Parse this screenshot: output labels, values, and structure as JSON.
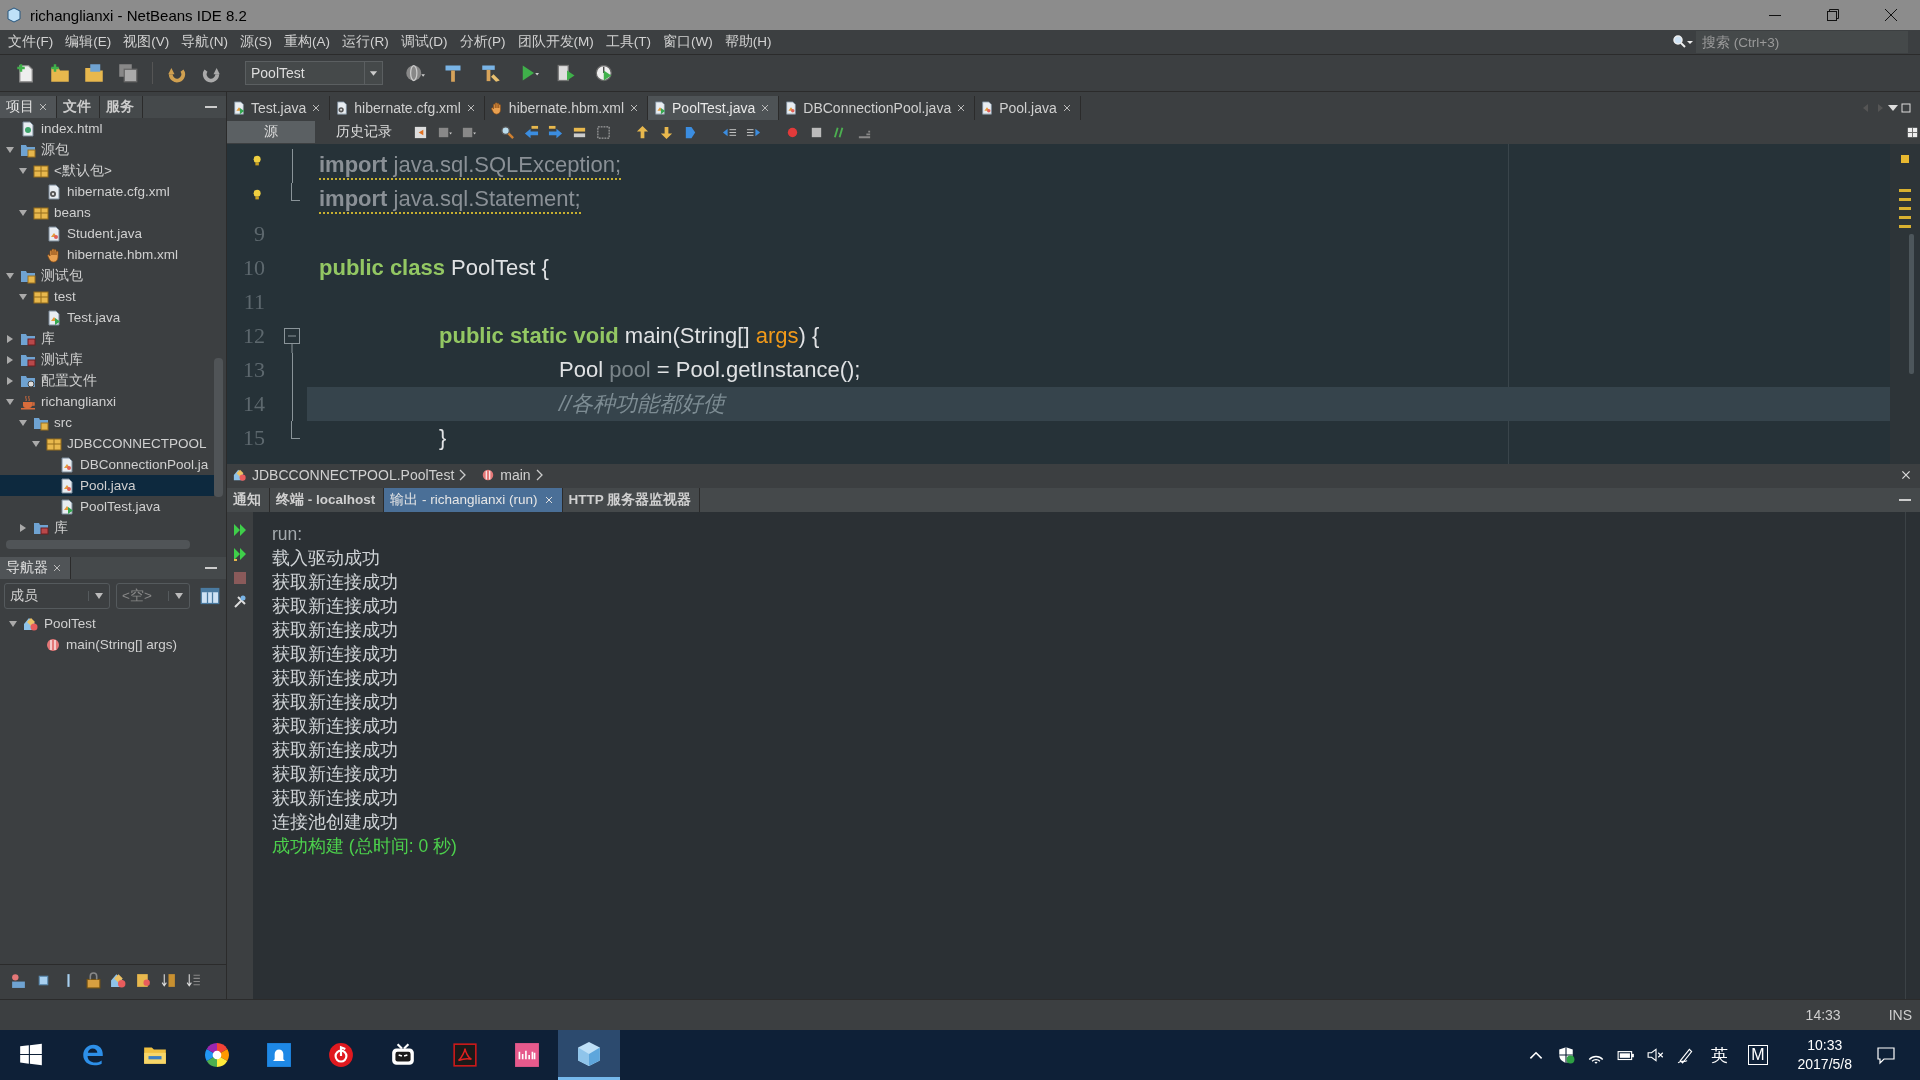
{
  "window": {
    "title": "richanglianxi - NetBeans IDE 8.2"
  },
  "menu": [
    "文件(F)",
    "编辑(E)",
    "视图(V)",
    "导航(N)",
    "源(S)",
    "重构(A)",
    "运行(R)",
    "调试(D)",
    "分析(P)",
    "团队开发(M)",
    "工具(T)",
    "窗口(W)",
    "帮助(H)"
  ],
  "search": {
    "placeholder": "搜索 (Ctrl+3)"
  },
  "toolbar": {
    "configuration": "PoolTest"
  },
  "project_panel": {
    "tabs": [
      {
        "label": "项目",
        "selected": true,
        "closable": true
      },
      {
        "label": "文件",
        "selected": false,
        "closable": false
      },
      {
        "label": "服务",
        "selected": false,
        "closable": false
      }
    ],
    "tree": [
      {
        "label": "index.html",
        "kind": "html",
        "selected": false
      },
      {
        "label": "源包",
        "kind": "source-root",
        "selected": false,
        "expanded": true,
        "children": [
          {
            "label": "<默认包>",
            "kind": "package",
            "selected": false,
            "expanded": true,
            "children": [
              {
                "label": "hibernate.cfg.xml",
                "kind": "xml",
                "selected": false
              }
            ]
          },
          {
            "label": "beans",
            "kind": "package",
            "selected": false,
            "expanded": true,
            "children": [
              {
                "label": "Student.java",
                "kind": "java",
                "selected": false
              },
              {
                "label": "hibernate.hbm.xml",
                "kind": "hbm",
                "selected": false
              }
            ]
          }
        ]
      },
      {
        "label": "测试包",
        "kind": "source-root",
        "selected": false,
        "expanded": true,
        "children": [
          {
            "label": "test",
            "kind": "package",
            "selected": false,
            "expanded": true,
            "children": [
              {
                "label": "Test.java",
                "kind": "java-main",
                "selected": false
              }
            ]
          }
        ]
      },
      {
        "label": "库",
        "kind": "library",
        "selected": false,
        "expanded": false
      },
      {
        "label": "测试库",
        "kind": "library",
        "selected": false,
        "expanded": false
      },
      {
        "label": "配置文件",
        "kind": "config",
        "selected": false,
        "expanded": false
      },
      {
        "label": "richanglianxi",
        "kind": "project",
        "selected": false,
        "expanded": true,
        "children": [
          {
            "label": "src",
            "kind": "source-root",
            "selected": false,
            "expanded": true,
            "children": [
              {
                "label": "JDBCCONNECTPOOL",
                "kind": "package",
                "selected": false,
                "expanded": true,
                "children": [
                  {
                    "label": "DBConnectionPool.ja",
                    "kind": "java",
                    "selected": false
                  },
                  {
                    "label": "Pool.java",
                    "kind": "java",
                    "selected": true
                  },
                  {
                    "label": "PoolTest.java",
                    "kind": "java-main",
                    "selected": false
                  }
                ]
              }
            ]
          },
          {
            "label": "库",
            "kind": "library",
            "selected": false,
            "expanded": false
          }
        ]
      }
    ]
  },
  "navigator": {
    "title": "导航器",
    "filters": [
      "成员",
      "<空>"
    ],
    "tree": [
      {
        "label": "PoolTest",
        "kind": "class",
        "selected": false,
        "expanded": true,
        "children": [
          {
            "label": "main(String[] args)",
            "kind": "method",
            "selected": false
          }
        ]
      }
    ]
  },
  "editor": {
    "tabs": [
      {
        "label": "Test.java",
        "kind": "java-main",
        "selected": false
      },
      {
        "label": "hibernate.cfg.xml",
        "kind": "xml",
        "selected": false
      },
      {
        "label": "hibernate.hbm.xml",
        "kind": "hbm",
        "selected": false
      },
      {
        "label": "PoolTest.java",
        "kind": "java-main",
        "selected": true
      },
      {
        "label": "DBConnectionPool.java",
        "kind": "java",
        "selected": false
      },
      {
        "label": "Pool.java",
        "kind": "java",
        "selected": false
      }
    ],
    "views": [
      {
        "label": "源",
        "selected": true
      },
      {
        "label": "历史记录",
        "selected": false
      }
    ],
    "lines": [
      {
        "hint": true,
        "fold": {
          "kind": "mid"
        },
        "current": false,
        "warning": true,
        "tokens": [
          {
            "kind": "import-keyword",
            "text": "import"
          },
          {
            "kind": "import",
            "text": " java.sql.SQLException;"
          }
        ]
      },
      {
        "hint": true,
        "fold": {
          "kind": "end"
        },
        "current": false,
        "warning": true,
        "tokens": [
          {
            "kind": "import-keyword",
            "text": "import"
          },
          {
            "kind": "import",
            "text": " java.sql.Statement;"
          }
        ]
      },
      {
        "number": "9",
        "hint": false,
        "current": false
      },
      {
        "number": "10",
        "hint": false,
        "current": false,
        "warning": false,
        "tokens": [
          {
            "kind": "keyword",
            "text": "public class"
          },
          {
            "kind": "plain",
            "text": " PoolTest {"
          }
        ]
      },
      {
        "number": "11",
        "hint": false,
        "current": false
      },
      {
        "number": "12",
        "hint": false,
        "fold": {
          "kind": "start"
        },
        "current": false,
        "warning": false,
        "tokens": [
          {
            "kind": "keyword",
            "text": "\tpublic static void"
          },
          {
            "kind": "plain",
            "text": " main(String[] "
          },
          {
            "kind": "param",
            "text": "args"
          },
          {
            "kind": "plain",
            "text": ") {"
          }
        ]
      },
      {
        "number": "13",
        "hint": false,
        "fold": {
          "kind": "mid"
        },
        "current": false,
        "warning": false,
        "tokens": [
          {
            "kind": "plain",
            "text": "\t\tPool "
          },
          {
            "kind": "unused",
            "text": "pool"
          },
          {
            "kind": "plain",
            "text": " = Pool.getInstance();"
          }
        ]
      },
      {
        "number": "14",
        "hint": false,
        "fold": {
          "kind": "mid"
        },
        "current": true,
        "warning": false,
        "tokens": [
          {
            "kind": "comment",
            "text": "\t\t//各种功能都好使"
          }
        ]
      },
      {
        "number": "15",
        "hint": false,
        "fold": {
          "kind": "end"
        },
        "current": false,
        "warning": false,
        "tokens": [
          {
            "kind": "plain",
            "text": "\t}"
          }
        ]
      }
    ],
    "breadcrumb": [
      {
        "label": "JDBCCONNECTPOOL.PoolTest",
        "kind": "class"
      },
      {
        "label": "main",
        "kind": "method"
      }
    ]
  },
  "output": {
    "tabs": [
      {
        "label": "通知",
        "selected": false,
        "closable": false
      },
      {
        "label": "终端 - localhost",
        "selected": false,
        "closable": false
      },
      {
        "label": "输出 - richanglianxi (run)",
        "selected": true,
        "closable": true
      },
      {
        "label": "HTTP 服务器监视器",
        "selected": false,
        "closable": false
      }
    ],
    "lines": [
      {
        "kind": "prompt",
        "text": "run:"
      },
      {
        "kind": "plain",
        "text": "载入驱动成功"
      },
      {
        "kind": "plain",
        "text": "获取新连接成功"
      },
      {
        "kind": "plain",
        "text": "获取新连接成功"
      },
      {
        "kind": "plain",
        "text": "获取新连接成功"
      },
      {
        "kind": "plain",
        "text": "获取新连接成功"
      },
      {
        "kind": "plain",
        "text": "获取新连接成功"
      },
      {
        "kind": "plain",
        "text": "获取新连接成功"
      },
      {
        "kind": "plain",
        "text": "获取新连接成功"
      },
      {
        "kind": "plain",
        "text": "获取新连接成功"
      },
      {
        "kind": "plain",
        "text": "获取新连接成功"
      },
      {
        "kind": "plain",
        "text": "获取新连接成功"
      },
      {
        "kind": "plain",
        "text": "连接池创建成功"
      },
      {
        "kind": "success",
        "text": "成功构建 (总时间: 0 秒)"
      }
    ]
  },
  "status_bar": {
    "position": "14:33",
    "mode": "INS"
  },
  "taskbar": {
    "apps": [
      {
        "kind": "start",
        "selected": false
      },
      {
        "kind": "browser",
        "selected": false
      },
      {
        "kind": "folder",
        "selected": false
      },
      {
        "kind": "color-wheel",
        "selected": false
      },
      {
        "kind": "bell-app",
        "selected": false
      },
      {
        "kind": "red-circle",
        "selected": false
      },
      {
        "kind": "tv",
        "selected": false
      },
      {
        "kind": "pdf",
        "selected": false
      },
      {
        "kind": "pink-app",
        "selected": false
      },
      {
        "kind": "cube",
        "selected": true
      }
    ],
    "tray": {
      "language": "英",
      "ime": "M",
      "time": "10:33",
      "date": "2017/5/8"
    }
  }
}
